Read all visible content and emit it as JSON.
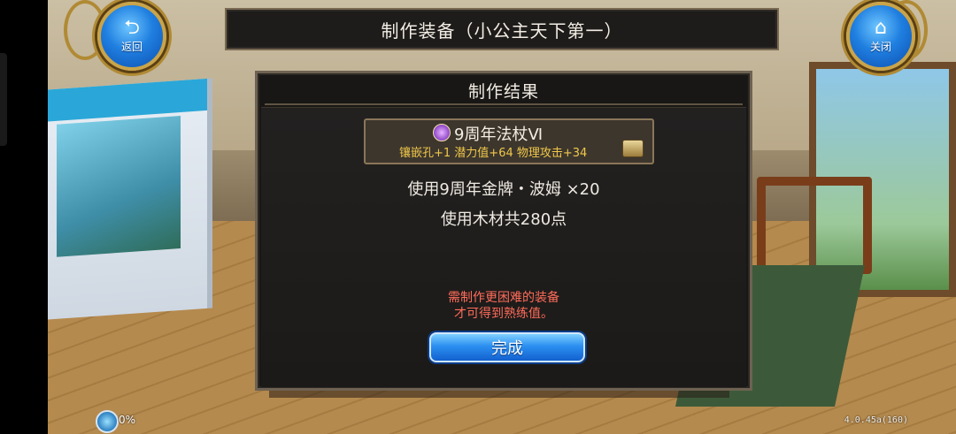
{
  "header": {
    "title": "制作装备（小公主天下第一）"
  },
  "nav": {
    "back_label": "返回",
    "back_icon": "return-arrow-icon",
    "close_label": "关闭",
    "close_icon": "home-icon"
  },
  "dialog": {
    "title": "制作结果",
    "item": {
      "name": "9周年法杖Ⅵ",
      "icon": "staff-icon",
      "stats": "镶嵌孔+1 潜力值+64 物理攻击+34",
      "badge_icon": "treasure-chest-icon"
    },
    "materials": [
      "使用9周年金牌・波姆 ×20",
      "使用木材共280点"
    ],
    "notice_lines": [
      "需制作更困难的装备",
      "才可得到熟练值。"
    ],
    "confirm_label": "完成"
  },
  "footer": {
    "loading_percent": "0%",
    "version": "4.0.45a(160)"
  },
  "colors": {
    "accent_blue": "#2b8ff0",
    "warning_red": "#ff6b5a",
    "stat_gold": "#f0c84a",
    "frame_gold": "#c9a44a"
  }
}
